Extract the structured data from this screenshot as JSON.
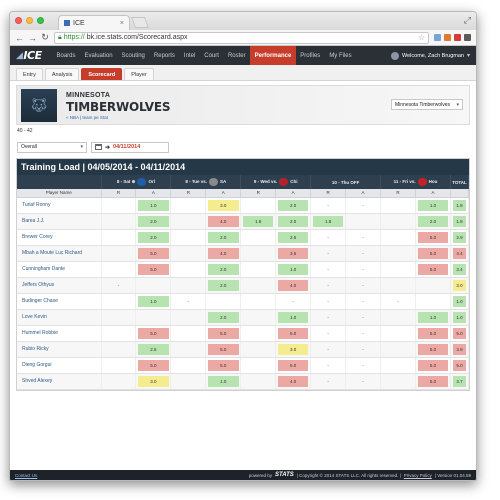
{
  "browser": {
    "tab_title": "ICE",
    "url_https": "https://",
    "url_rest": "bk.ice.stats.com/Scorecard.aspx"
  },
  "app": {
    "logo": "ICE",
    "nav": [
      "Boards",
      "Evaluation",
      "Scouting",
      "Reports",
      "Intel",
      "Court",
      "Roster",
      "Performance",
      "Profiles",
      "My Files"
    ],
    "nav_active": "Performance",
    "welcome": "Welcome, Zach Brugman"
  },
  "subtabs": [
    "Entry",
    "Analysis",
    "Scorecard",
    "Player"
  ],
  "subtab_active": "Scorecard",
  "team": {
    "city": "MINNESOTA",
    "name": "TIMBERWOLVES",
    "links": "« NBA | team pe Stat",
    "select_value": "Minnesota Timberwolves",
    "record": "40 - 42"
  },
  "filters": {
    "period": "Overall",
    "date": "04/11/2014"
  },
  "load": {
    "title": "Training Load | 04/05/2014 - 04/11/2014",
    "games": [
      {
        "label": "8 - Sat ⊕",
        "opp": "Orl",
        "color": "#1f5fa8"
      },
      {
        "label": "8 - Tue vs.",
        "opp": "SA",
        "color": "#8a8a8a"
      },
      {
        "label": "9 - Wed vs.",
        "opp": "Chi",
        "color": "#b5222b"
      },
      {
        "label": "10 - Thu OFF",
        "opp": "",
        "color": ""
      },
      {
        "label": "11 - Fri vs.",
        "opp": "Hou",
        "color": "#c62127"
      }
    ],
    "total_label": "TOTAL",
    "player_header": "Player Name",
    "r_label": "R",
    "a_label": "A",
    "players": [
      {
        "name": "Turiaf Ronny",
        "g": [
          "",
          "1.0",
          "",
          "3.0",
          "",
          "2.0",
          "-",
          "-",
          "",
          "1.0"
        ],
        "c": [
          "",
          "g",
          "",
          "y",
          "",
          "g",
          "",
          "",
          "",
          "g"
        ],
        "total": "1.8",
        "tc": "g"
      },
      {
        "name": "Barea J.J.",
        "g": [
          "",
          "2.0",
          "",
          "4.0",
          "1.8",
          "2.0",
          "1.8",
          "",
          "",
          "2.0"
        ],
        "c": [
          "",
          "g",
          "",
          "r",
          "g",
          "g",
          "g",
          "",
          "",
          "g"
        ],
        "total": "1.8",
        "tc": "g",
        "extra": "2.8"
      },
      {
        "name": "Brewer Corey",
        "g": [
          "",
          "2.0",
          "",
          "2.0",
          "",
          "2.5",
          "-",
          "-",
          "",
          "5.0"
        ],
        "c": [
          "",
          "g",
          "",
          "g",
          "",
          "g",
          "",
          "",
          "",
          "r"
        ],
        "total": "2.9",
        "tc": "g"
      },
      {
        "name": "Mbah a Moute Luc Richard",
        "g": [
          "",
          "5.0",
          "",
          "4.0",
          "",
          "3.5",
          "-",
          "-",
          "",
          "5.0"
        ],
        "c": [
          "",
          "r",
          "",
          "r",
          "",
          "r",
          "",
          "",
          "",
          "r"
        ],
        "total": "4.4",
        "tc": "r"
      },
      {
        "name": "Cunningham Dante",
        "g": [
          "",
          "5.0",
          "",
          "2.0",
          "",
          "1.0",
          "-",
          "-",
          "",
          "5.0"
        ],
        "c": [
          "",
          "r",
          "",
          "g",
          "",
          "g",
          "",
          "",
          "",
          "r"
        ],
        "total": "3.4",
        "tc": "g"
      },
      {
        "name": "Jeffers Othyus",
        "g": [
          "-",
          "",
          "",
          "2.0",
          "",
          "4.0",
          "-",
          "-",
          "",
          ""
        ],
        "c": [
          "",
          "",
          "",
          "g",
          "",
          "r",
          "",
          "",
          "",
          ""
        ],
        "total": "3.0",
        "tc": "y"
      },
      {
        "name": "Budinger Chase",
        "g": [
          "",
          "1.0",
          "-",
          "",
          "",
          "-",
          "-",
          "-",
          "-",
          ""
        ],
        "c": [
          "",
          "g",
          "",
          "",
          "",
          "",
          "",
          "",
          "",
          ""
        ],
        "total": "1.0",
        "tc": "g"
      },
      {
        "name": "Love Kevin",
        "g": [
          "",
          "",
          "",
          "2.0",
          "",
          "1.0",
          "-",
          "-",
          "",
          "1.0"
        ],
        "c": [
          "",
          "",
          "",
          "g",
          "",
          "g",
          "",
          "",
          "",
          "g"
        ],
        "total": "1.0",
        "tc": "g"
      },
      {
        "name": "Hummel Robbie",
        "g": [
          "",
          "5.0",
          "",
          "5.0",
          "",
          "5.0",
          "-",
          "-",
          "",
          "5.0"
        ],
        "c": [
          "",
          "r",
          "",
          "r",
          "",
          "r",
          "",
          "",
          "",
          "r"
        ],
        "total": "5.0",
        "tc": "r"
      },
      {
        "name": "Rubio Ricky",
        "g": [
          "",
          "2.5",
          "",
          "5.0",
          "",
          "3.0",
          "-",
          "-",
          "",
          "5.0"
        ],
        "c": [
          "",
          "g",
          "",
          "r",
          "",
          "y",
          "",
          "",
          "",
          "r"
        ],
        "total": "3.9",
        "tc": "r"
      },
      {
        "name": "Dieng Gorgui",
        "g": [
          "",
          "5.0",
          "",
          "5.0",
          "",
          "5.0",
          "-",
          "-",
          "",
          "5.0"
        ],
        "c": [
          "",
          "r",
          "",
          "r",
          "",
          "r",
          "",
          "",
          "",
          "r"
        ],
        "total": "5.0",
        "tc": "r"
      },
      {
        "name": "Shved Alexey",
        "g": [
          "",
          "3.0",
          "",
          "1.0",
          "",
          "4.0",
          "-",
          "-",
          "",
          "5.0"
        ],
        "c": [
          "",
          "y",
          "",
          "g",
          "",
          "r",
          "",
          "",
          "",
          "r"
        ],
        "total": "3.7",
        "tc": "g"
      }
    ]
  },
  "footer": {
    "contact": "Contact Us",
    "powered": "powered by",
    "stats": "STATS",
    "copyright": "| Copyright © 2014 STATS LLC. All rights reserved. |",
    "privacy": "Privacy Policy",
    "version": "| Version 01.04.59"
  }
}
